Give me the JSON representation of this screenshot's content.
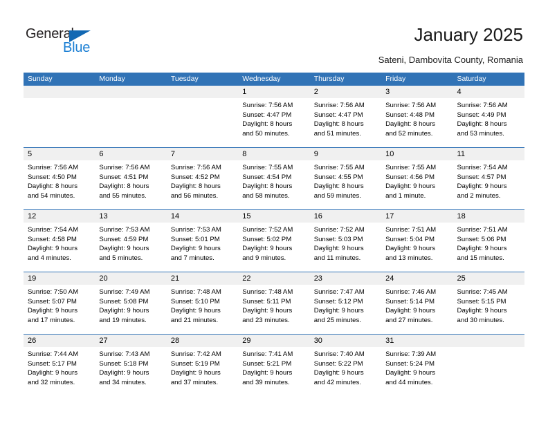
{
  "brand": {
    "name_part1": "General",
    "name_part2": "Blue"
  },
  "header": {
    "title": "January 2025",
    "subtitle": "Sateni, Dambovita County, Romania"
  },
  "colors": {
    "header_blue": "#3173b6",
    "number_band": "#f0f0f0",
    "logo_blue": "#1b7fd4",
    "logo_triangle": "#1268b3"
  },
  "weekdays": [
    "Sunday",
    "Monday",
    "Tuesday",
    "Wednesday",
    "Thursday",
    "Friday",
    "Saturday"
  ],
  "weeks": [
    {
      "numbers": [
        "",
        "",
        "",
        "1",
        "2",
        "3",
        "4"
      ],
      "cells": [
        {
          "lines": [
            "",
            "",
            "",
            ""
          ]
        },
        {
          "lines": [
            "",
            "",
            "",
            ""
          ]
        },
        {
          "lines": [
            "",
            "",
            "",
            ""
          ]
        },
        {
          "lines": [
            "Sunrise: 7:56 AM",
            "Sunset: 4:47 PM",
            "Daylight: 8 hours",
            "and 50 minutes."
          ]
        },
        {
          "lines": [
            "Sunrise: 7:56 AM",
            "Sunset: 4:47 PM",
            "Daylight: 8 hours",
            "and 51 minutes."
          ]
        },
        {
          "lines": [
            "Sunrise: 7:56 AM",
            "Sunset: 4:48 PM",
            "Daylight: 8 hours",
            "and 52 minutes."
          ]
        },
        {
          "lines": [
            "Sunrise: 7:56 AM",
            "Sunset: 4:49 PM",
            "Daylight: 8 hours",
            "and 53 minutes."
          ]
        }
      ]
    },
    {
      "numbers": [
        "5",
        "6",
        "7",
        "8",
        "9",
        "10",
        "11"
      ],
      "cells": [
        {
          "lines": [
            "Sunrise: 7:56 AM",
            "Sunset: 4:50 PM",
            "Daylight: 8 hours",
            "and 54 minutes."
          ]
        },
        {
          "lines": [
            "Sunrise: 7:56 AM",
            "Sunset: 4:51 PM",
            "Daylight: 8 hours",
            "and 55 minutes."
          ]
        },
        {
          "lines": [
            "Sunrise: 7:56 AM",
            "Sunset: 4:52 PM",
            "Daylight: 8 hours",
            "and 56 minutes."
          ]
        },
        {
          "lines": [
            "Sunrise: 7:55 AM",
            "Sunset: 4:54 PM",
            "Daylight: 8 hours",
            "and 58 minutes."
          ]
        },
        {
          "lines": [
            "Sunrise: 7:55 AM",
            "Sunset: 4:55 PM",
            "Daylight: 8 hours",
            "and 59 minutes."
          ]
        },
        {
          "lines": [
            "Sunrise: 7:55 AM",
            "Sunset: 4:56 PM",
            "Daylight: 9 hours",
            "and 1 minute."
          ]
        },
        {
          "lines": [
            "Sunrise: 7:54 AM",
            "Sunset: 4:57 PM",
            "Daylight: 9 hours",
            "and 2 minutes."
          ]
        }
      ]
    },
    {
      "numbers": [
        "12",
        "13",
        "14",
        "15",
        "16",
        "17",
        "18"
      ],
      "cells": [
        {
          "lines": [
            "Sunrise: 7:54 AM",
            "Sunset: 4:58 PM",
            "Daylight: 9 hours",
            "and 4 minutes."
          ]
        },
        {
          "lines": [
            "Sunrise: 7:53 AM",
            "Sunset: 4:59 PM",
            "Daylight: 9 hours",
            "and 5 minutes."
          ]
        },
        {
          "lines": [
            "Sunrise: 7:53 AM",
            "Sunset: 5:01 PM",
            "Daylight: 9 hours",
            "and 7 minutes."
          ]
        },
        {
          "lines": [
            "Sunrise: 7:52 AM",
            "Sunset: 5:02 PM",
            "Daylight: 9 hours",
            "and 9 minutes."
          ]
        },
        {
          "lines": [
            "Sunrise: 7:52 AM",
            "Sunset: 5:03 PM",
            "Daylight: 9 hours",
            "and 11 minutes."
          ]
        },
        {
          "lines": [
            "Sunrise: 7:51 AM",
            "Sunset: 5:04 PM",
            "Daylight: 9 hours",
            "and 13 minutes."
          ]
        },
        {
          "lines": [
            "Sunrise: 7:51 AM",
            "Sunset: 5:06 PM",
            "Daylight: 9 hours",
            "and 15 minutes."
          ]
        }
      ]
    },
    {
      "numbers": [
        "19",
        "20",
        "21",
        "22",
        "23",
        "24",
        "25"
      ],
      "cells": [
        {
          "lines": [
            "Sunrise: 7:50 AM",
            "Sunset: 5:07 PM",
            "Daylight: 9 hours",
            "and 17 minutes."
          ]
        },
        {
          "lines": [
            "Sunrise: 7:49 AM",
            "Sunset: 5:08 PM",
            "Daylight: 9 hours",
            "and 19 minutes."
          ]
        },
        {
          "lines": [
            "Sunrise: 7:48 AM",
            "Sunset: 5:10 PM",
            "Daylight: 9 hours",
            "and 21 minutes."
          ]
        },
        {
          "lines": [
            "Sunrise: 7:48 AM",
            "Sunset: 5:11 PM",
            "Daylight: 9 hours",
            "and 23 minutes."
          ]
        },
        {
          "lines": [
            "Sunrise: 7:47 AM",
            "Sunset: 5:12 PM",
            "Daylight: 9 hours",
            "and 25 minutes."
          ]
        },
        {
          "lines": [
            "Sunrise: 7:46 AM",
            "Sunset: 5:14 PM",
            "Daylight: 9 hours",
            "and 27 minutes."
          ]
        },
        {
          "lines": [
            "Sunrise: 7:45 AM",
            "Sunset: 5:15 PM",
            "Daylight: 9 hours",
            "and 30 minutes."
          ]
        }
      ]
    },
    {
      "numbers": [
        "26",
        "27",
        "28",
        "29",
        "30",
        "31",
        ""
      ],
      "cells": [
        {
          "lines": [
            "Sunrise: 7:44 AM",
            "Sunset: 5:17 PM",
            "Daylight: 9 hours",
            "and 32 minutes."
          ]
        },
        {
          "lines": [
            "Sunrise: 7:43 AM",
            "Sunset: 5:18 PM",
            "Daylight: 9 hours",
            "and 34 minutes."
          ]
        },
        {
          "lines": [
            "Sunrise: 7:42 AM",
            "Sunset: 5:19 PM",
            "Daylight: 9 hours",
            "and 37 minutes."
          ]
        },
        {
          "lines": [
            "Sunrise: 7:41 AM",
            "Sunset: 5:21 PM",
            "Daylight: 9 hours",
            "and 39 minutes."
          ]
        },
        {
          "lines": [
            "Sunrise: 7:40 AM",
            "Sunset: 5:22 PM",
            "Daylight: 9 hours",
            "and 42 minutes."
          ]
        },
        {
          "lines": [
            "Sunrise: 7:39 AM",
            "Sunset: 5:24 PM",
            "Daylight: 9 hours",
            "and 44 minutes."
          ]
        },
        {
          "lines": [
            "",
            "",
            "",
            ""
          ]
        }
      ]
    }
  ]
}
